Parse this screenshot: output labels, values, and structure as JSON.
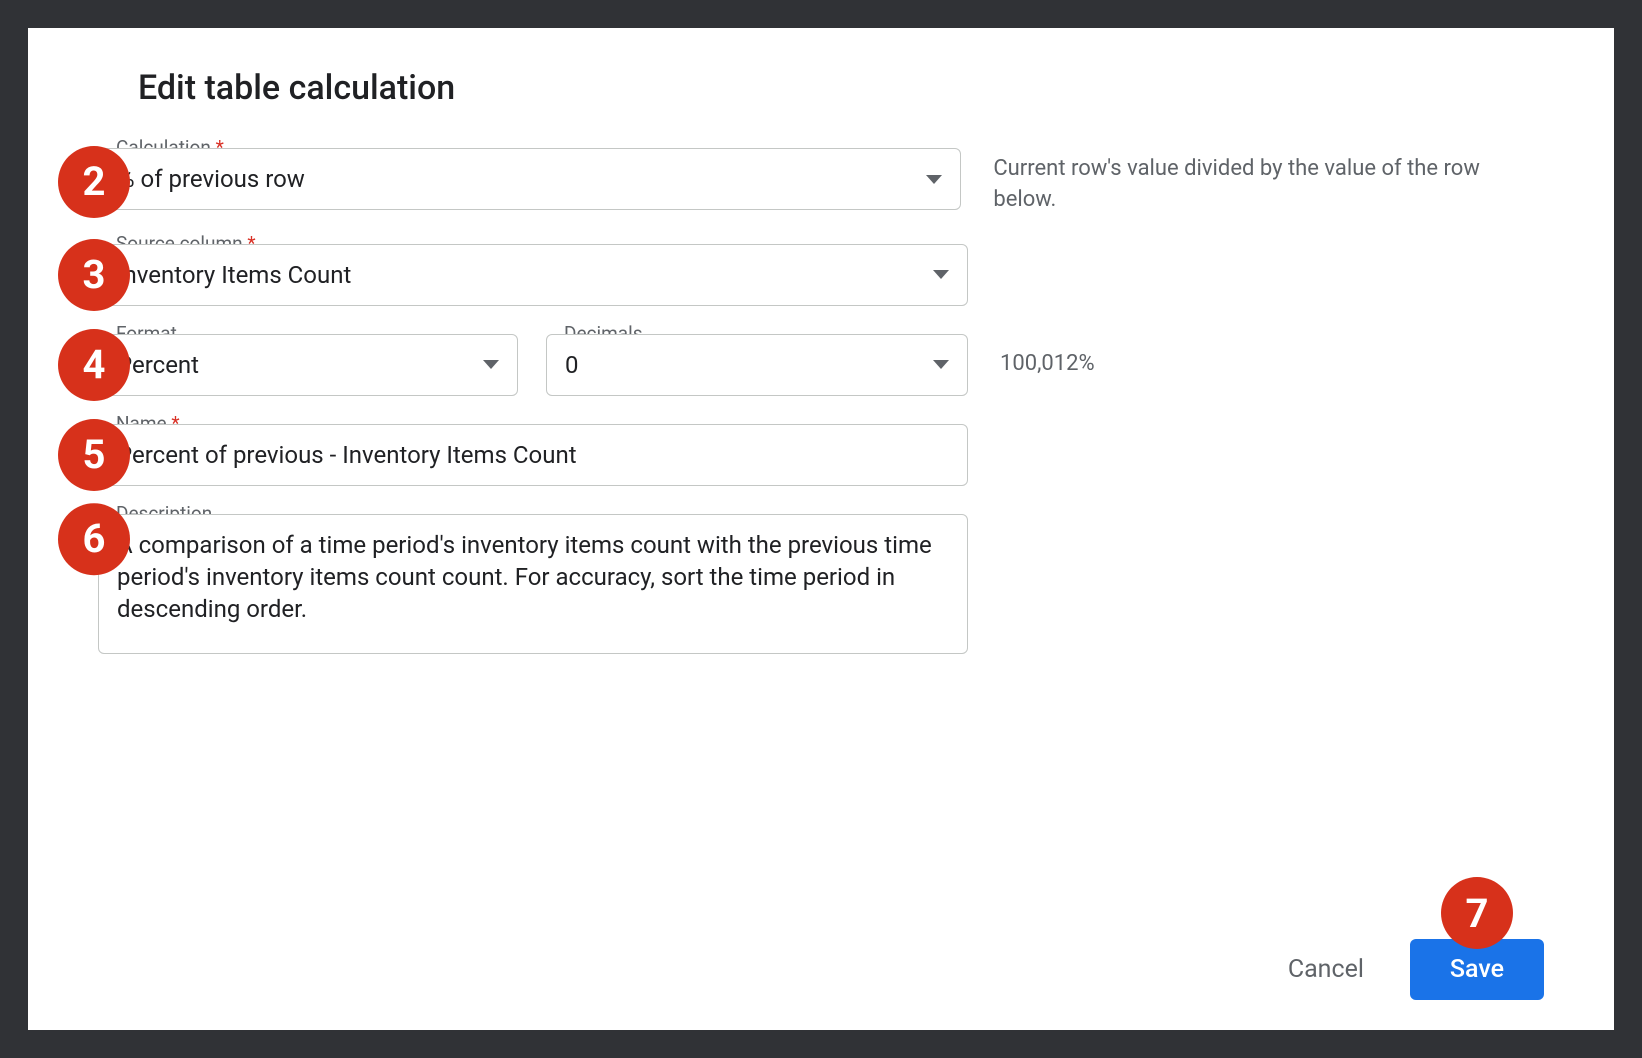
{
  "dialog": {
    "title": "Edit table calculation"
  },
  "markers": {
    "calculation": "2",
    "source_column": "3",
    "format": "4",
    "name": "5",
    "description": "6",
    "save": "7"
  },
  "fields": {
    "calculation": {
      "label": "Calculation",
      "value": "% of previous row",
      "help": "Current row's value divided by the value of the row below."
    },
    "source_column": {
      "label": "Source column",
      "value": "Inventory Items Count"
    },
    "format": {
      "label": "Format",
      "value": "Percent"
    },
    "decimals": {
      "label": "Decimals",
      "value": "0"
    },
    "format_preview": "100,012%",
    "name": {
      "label": "Name",
      "value": "Percent of previous -  Inventory Items Count"
    },
    "description": {
      "label": "Description",
      "value": "A comparison of a time period's inventory items count with the previous time period's inventory items count count. For accuracy, sort the time period in descending order."
    }
  },
  "actions": {
    "cancel": "Cancel",
    "save": "Save"
  }
}
